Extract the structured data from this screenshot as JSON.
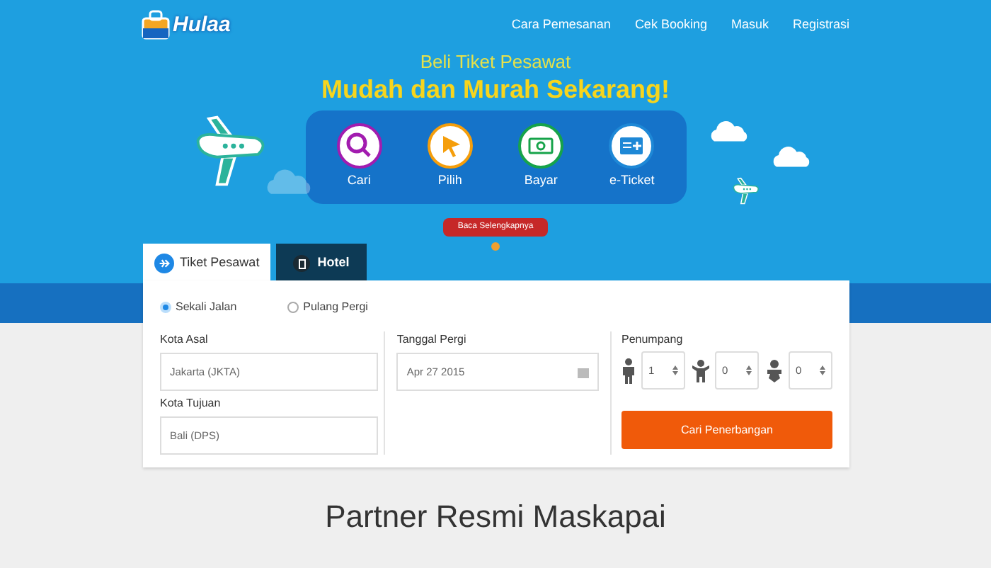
{
  "logo": {
    "text": "Hulaa"
  },
  "nav": [
    "Cara Pemesanan",
    "Cek Booking",
    "Masuk",
    "Registrasi"
  ],
  "hero": {
    "subtitle": "Beli Tiket Pesawat",
    "title": "Mudah dan Murah Sekarang!",
    "steps": [
      {
        "kind": "search",
        "label": "Cari"
      },
      {
        "kind": "pointer",
        "label": "Pilih"
      },
      {
        "kind": "money",
        "label": "Bayar"
      },
      {
        "kind": "ticket",
        "label": "e-Ticket"
      }
    ],
    "more_button": "Baca Selengkapnya"
  },
  "tabs": [
    {
      "kind": "plane",
      "label": "Tiket Pesawat",
      "selected": true
    },
    {
      "kind": "hotel",
      "label": "Hotel",
      "selected": false
    }
  ],
  "trip_type": [
    {
      "label": "Sekali Jalan",
      "selected": true
    },
    {
      "label": "Pulang Pergi",
      "selected": false
    }
  ],
  "form": {
    "origin": {
      "label": "Kota Asal",
      "value": "Jakarta (JKTA)"
    },
    "destination": {
      "label": "Kota Tujuan",
      "value": "Bali (DPS)"
    },
    "date": {
      "label": "Tanggal Pergi",
      "value": "Apr 27 2015"
    },
    "passengers": {
      "label": "Penumpang",
      "counts": [
        {
          "kind": "adult",
          "value": "1"
        },
        {
          "kind": "child",
          "value": "0"
        },
        {
          "kind": "infant",
          "value": "0"
        }
      ]
    },
    "search_button": "Cari Penerbangan"
  },
  "partners": {
    "title": "Partner Resmi Maskapai"
  }
}
